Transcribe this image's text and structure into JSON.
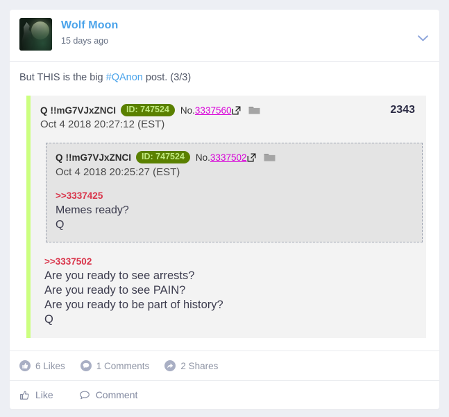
{
  "post": {
    "author": "Wolf Moon",
    "timestamp": "15 days ago",
    "avatar_icon": "wolf-moon-avatar",
    "caret_icon": "chevron-down-icon",
    "text_before": "But THIS is the big ",
    "hashtag": "#QAnon",
    "text_after": " post. (3/3)"
  },
  "quote_outer": {
    "name": "Q",
    "tripcode": "!!mG7VJxZNCI",
    "id_badge": "ID: 747524",
    "no_label": "No.",
    "no_link": "3337560",
    "ext_icon": "external-link-icon",
    "folder_icon": "folder-icon",
    "count": "2343",
    "date": "Oct 4 2018 20:27:12 (EST)",
    "reference": ">>3337502",
    "lines": [
      "Are you ready to see arrests?",
      "Are you ready to see PAIN?",
      "Are you ready to be part of history?",
      "Q"
    ]
  },
  "quote_inner": {
    "name": "Q",
    "tripcode": "!!mG7VJxZNCI",
    "id_badge": "ID: 747524",
    "no_label": "No.",
    "no_link": "3337502",
    "ext_icon": "external-link-icon",
    "folder_icon": "folder-icon",
    "date": "Oct 4 2018 20:25:27 (EST)",
    "reference": ">>3337425",
    "lines": [
      "Memes ready?",
      "Q"
    ]
  },
  "stats": [
    {
      "icon": "thumbs-up-circle-icon",
      "label": "6 Likes"
    },
    {
      "icon": "comment-circle-icon",
      "label": "1 Comments"
    },
    {
      "icon": "share-circle-icon",
      "label": "2 Shares"
    }
  ],
  "actions": [
    {
      "icon": "thumbs-up-outline-icon",
      "label": "Like"
    },
    {
      "icon": "comment-outline-icon",
      "label": "Comment"
    }
  ],
  "colors": {
    "page_background": "#edeff4",
    "card_background": "#ffffff",
    "author_link": "#4aa3ea",
    "quote_accent": "#ccff80",
    "quote_background": "#f3f3f3",
    "inner_quote_background": "#e4e4e4",
    "id_badge_background": "#5a8000",
    "id_badge_text": "#bfe87f",
    "post_link": "#d800d8",
    "reference_text": "#d9344a",
    "muted_text": "#8f95a5"
  }
}
